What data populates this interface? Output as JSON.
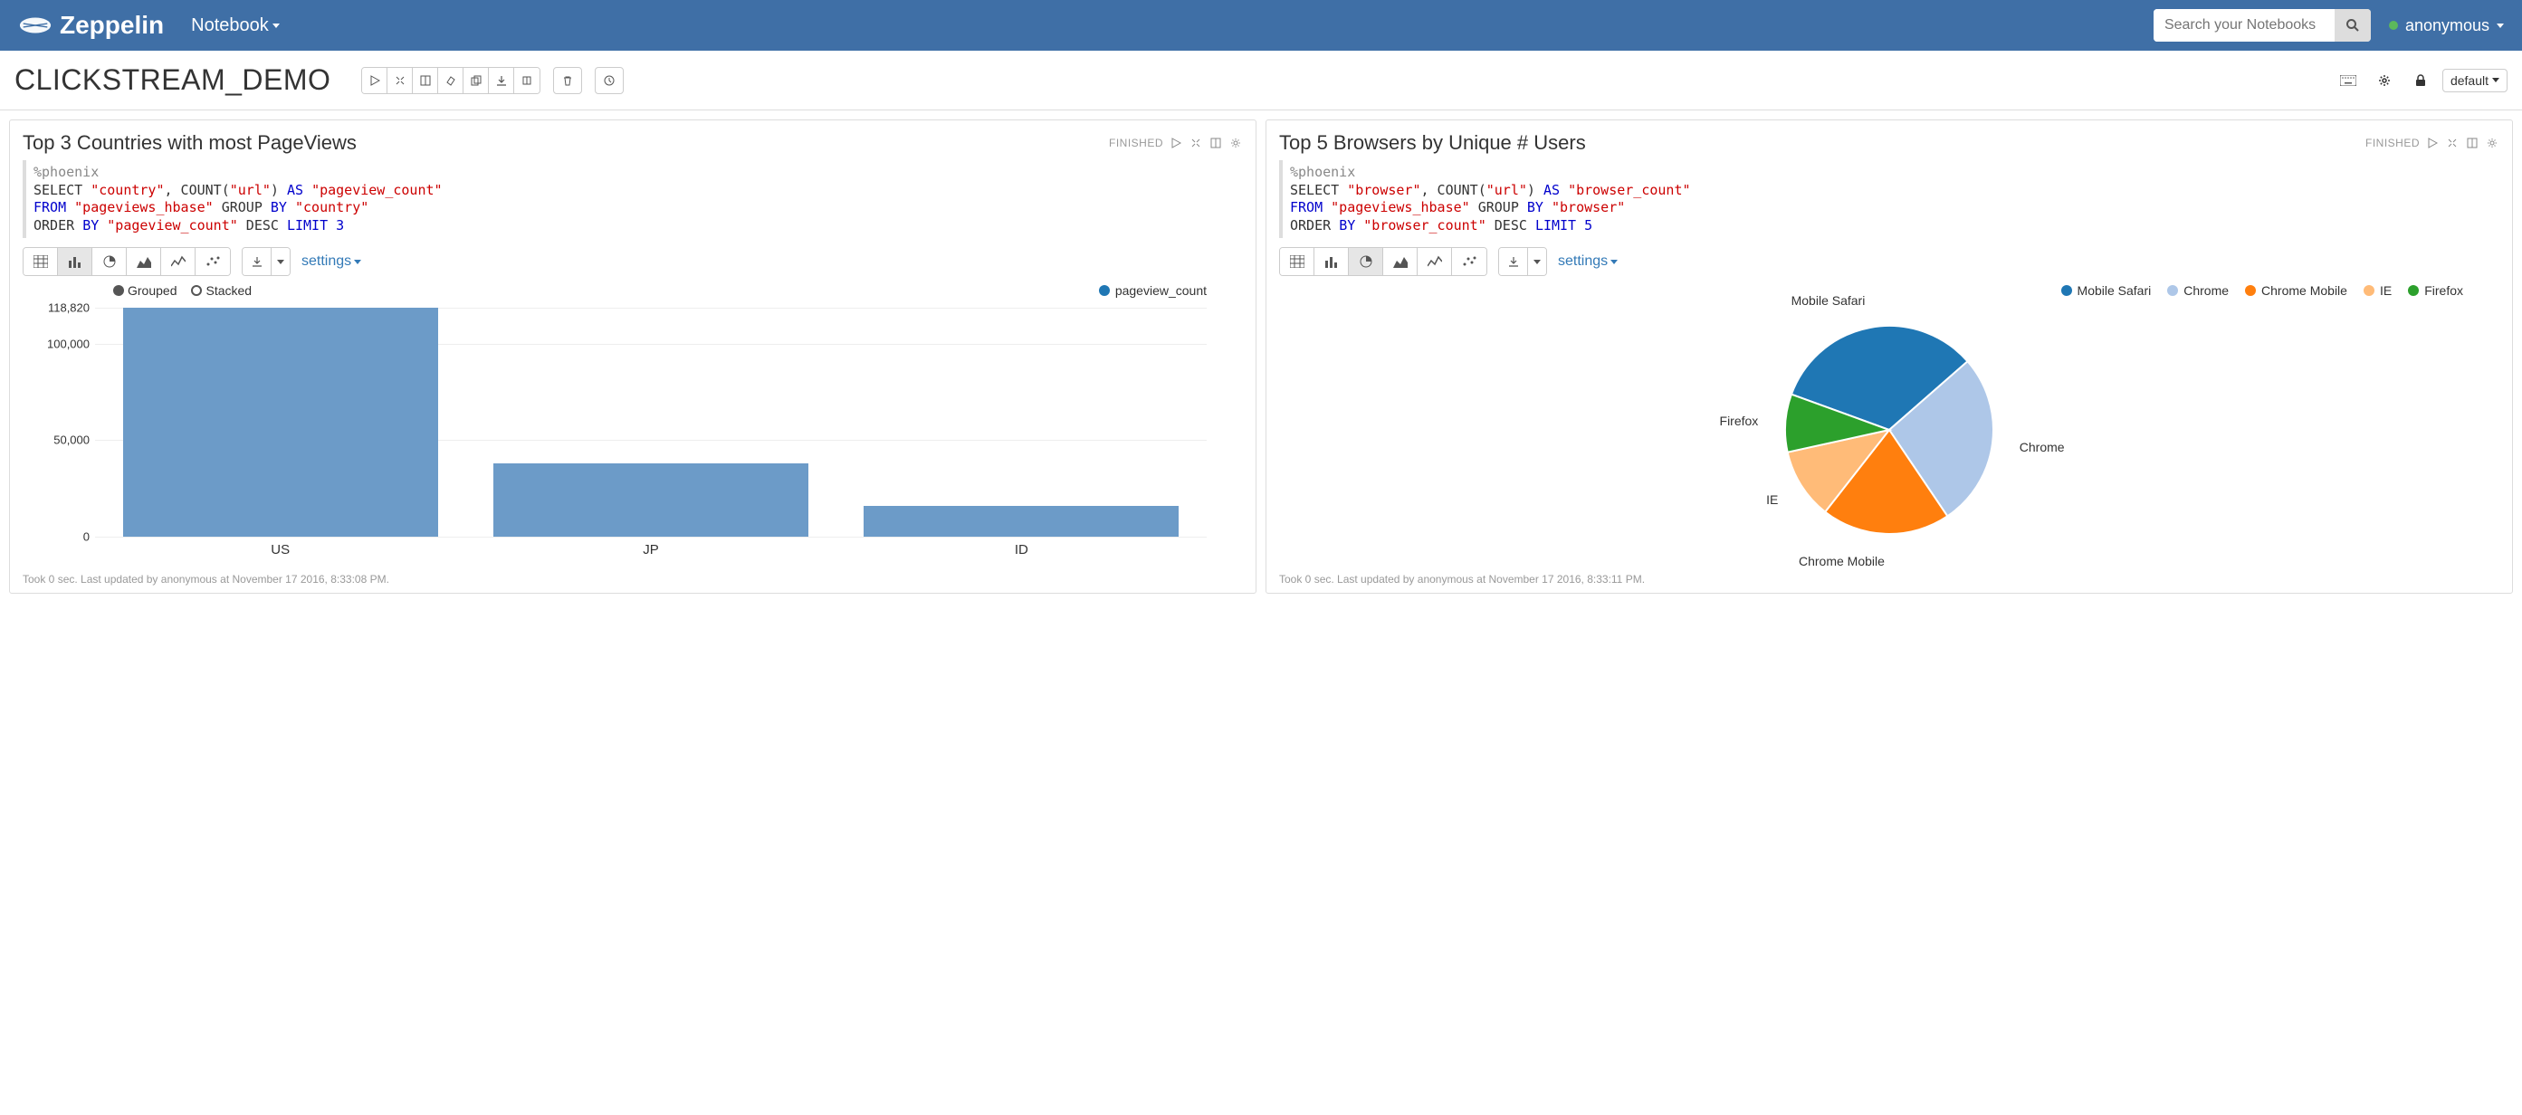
{
  "nav": {
    "brand": "Zeppelin",
    "notebook_menu": "Notebook",
    "search_placeholder": "Search your Notebooks",
    "user": "anonymous"
  },
  "toolbar": {
    "title": "CLICKSTREAM_DEMO",
    "default_label": "default"
  },
  "paragraphs": [
    {
      "title": "Top 3 Countries with most PageViews",
      "status": "FINISHED",
      "code_lines": [
        [
          {
            "t": "%phoenix",
            "c": "grey"
          }
        ],
        [
          {
            "t": "SELECT ",
            "c": ""
          },
          {
            "t": "\"country\"",
            "c": "str"
          },
          {
            "t": ", COUNT(",
            "c": ""
          },
          {
            "t": "\"url\"",
            "c": "str"
          },
          {
            "t": ") ",
            "c": ""
          },
          {
            "t": "AS ",
            "c": "kw"
          },
          {
            "t": "\"pageview_count\"",
            "c": "str"
          }
        ],
        [
          {
            "t": "FROM ",
            "c": "kw"
          },
          {
            "t": "\"pageviews_hbase\"",
            "c": "str"
          },
          {
            "t": " GROUP ",
            "c": ""
          },
          {
            "t": "BY ",
            "c": "kw"
          },
          {
            "t": "\"country\"",
            "c": "str"
          }
        ],
        [
          {
            "t": "ORDER ",
            "c": ""
          },
          {
            "t": "BY ",
            "c": "kw"
          },
          {
            "t": "\"pageview_count\"",
            "c": "str"
          },
          {
            "t": " DESC ",
            "c": ""
          },
          {
            "t": "LIMIT ",
            "c": "kw"
          },
          {
            "t": "3",
            "c": "num"
          }
        ]
      ],
      "settings_label": "settings",
      "legend_grouped": "Grouped",
      "legend_stacked": "Stacked",
      "legend_series": "pageview_count",
      "footer": "Took 0 sec. Last updated by anonymous at November 17 2016, 8:33:08 PM."
    },
    {
      "title": "Top 5 Browsers by Unique # Users",
      "status": "FINISHED",
      "code_lines": [
        [
          {
            "t": "%phoenix",
            "c": "grey"
          }
        ],
        [
          {
            "t": "SELECT ",
            "c": ""
          },
          {
            "t": "\"browser\"",
            "c": "str"
          },
          {
            "t": ", COUNT(",
            "c": ""
          },
          {
            "t": "\"url\"",
            "c": "str"
          },
          {
            "t": ") ",
            "c": ""
          },
          {
            "t": "AS ",
            "c": "kw"
          },
          {
            "t": "\"browser_count\"",
            "c": "str"
          }
        ],
        [
          {
            "t": "FROM ",
            "c": "kw"
          },
          {
            "t": "\"pageviews_hbase\"",
            "c": "str"
          },
          {
            "t": " GROUP ",
            "c": ""
          },
          {
            "t": "BY ",
            "c": "kw"
          },
          {
            "t": "\"browser\"",
            "c": "str"
          }
        ],
        [
          {
            "t": "ORDER ",
            "c": ""
          },
          {
            "t": "BY ",
            "c": "kw"
          },
          {
            "t": "\"browser_count\"",
            "c": "str"
          },
          {
            "t": " DESC ",
            "c": ""
          },
          {
            "t": "LIMIT ",
            "c": "kw"
          },
          {
            "t": "5",
            "c": "num"
          }
        ]
      ],
      "settings_label": "settings",
      "footer": "Took 0 sec. Last updated by anonymous at November 17 2016, 8:33:11 PM."
    }
  ],
  "chart_data": [
    {
      "type": "bar",
      "title": "Top 3 Countries with most PageViews",
      "series_name": "pageview_count",
      "categories": [
        "US",
        "JP",
        "ID"
      ],
      "values": [
        118820,
        38000,
        16000
      ],
      "yticks": [
        0,
        50000,
        100000,
        118820
      ],
      "ytick_labels": [
        "0",
        "50,000",
        "100,000",
        "118,820"
      ],
      "ylim": [
        0,
        120000
      ],
      "color": "#6C9BC8"
    },
    {
      "type": "pie",
      "title": "Top 5 Browsers by Unique # Users",
      "series": [
        {
          "name": "Mobile Safari",
          "value": 33,
          "color": "#1f77b4"
        },
        {
          "name": "Chrome",
          "value": 27,
          "color": "#aec7e8"
        },
        {
          "name": "Chrome Mobile",
          "value": 20,
          "color": "#ff7f0e"
        },
        {
          "name": "IE",
          "value": 11,
          "color": "#ffbb78"
        },
        {
          "name": "Firefox",
          "value": 9,
          "color": "#2ca02c"
        }
      ]
    }
  ]
}
